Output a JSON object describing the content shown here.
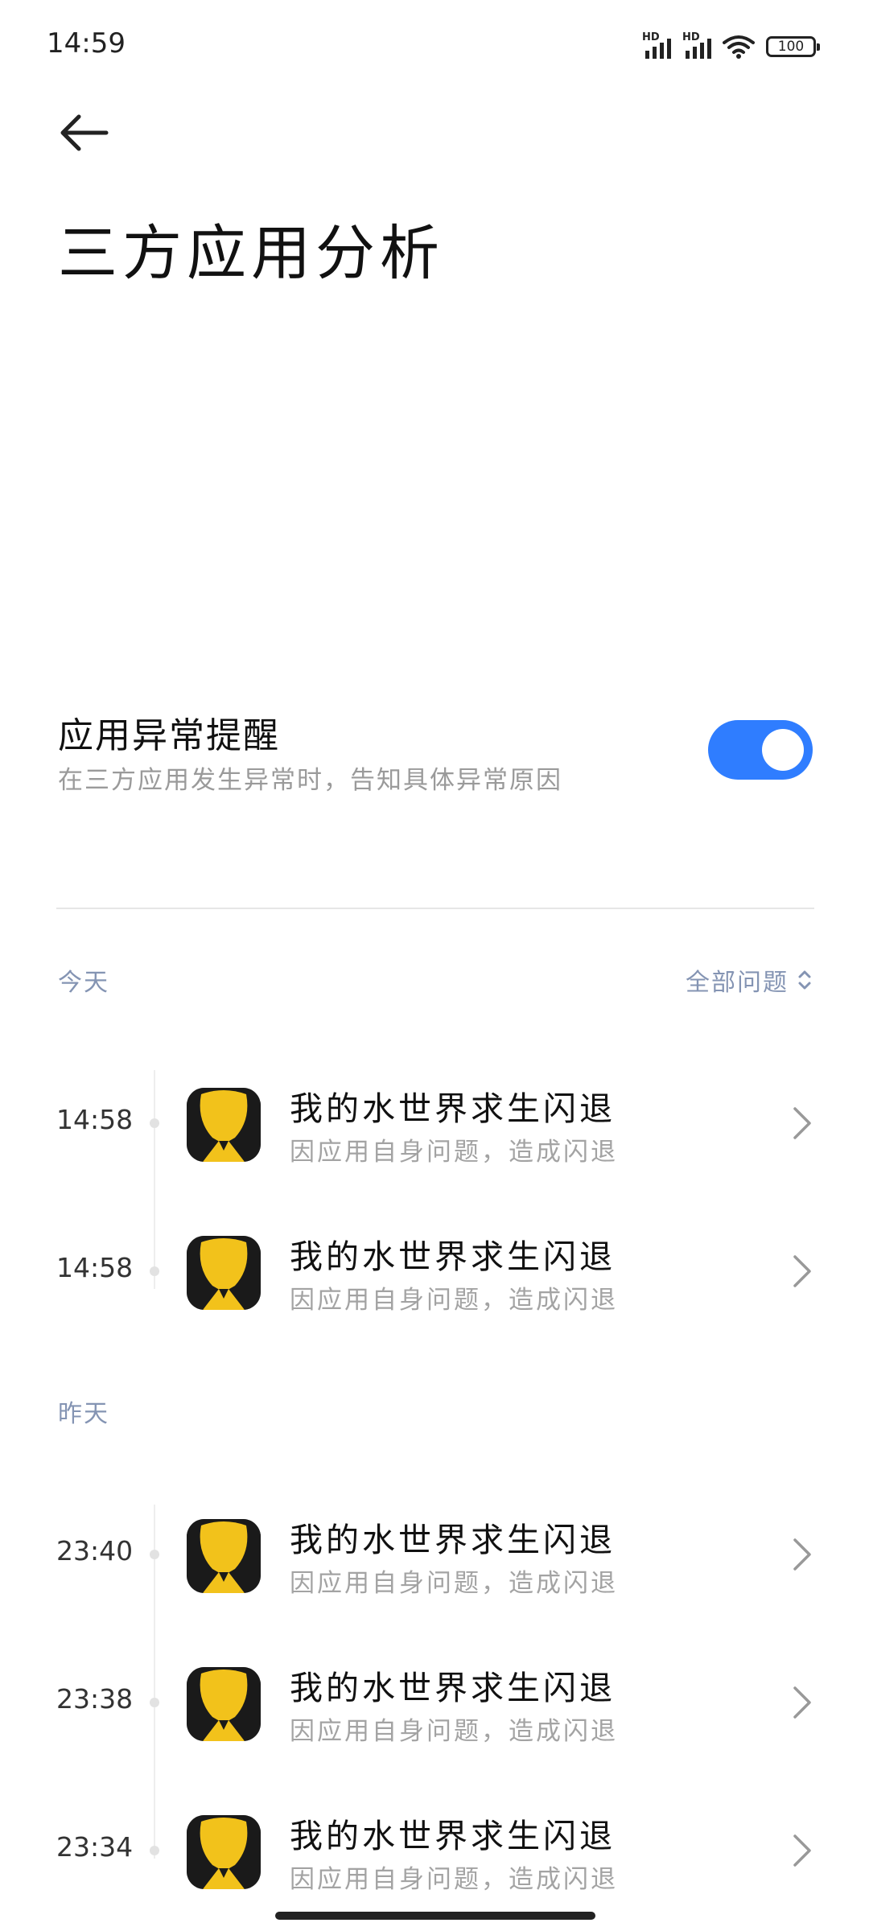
{
  "status_bar": {
    "time": "14:59",
    "sim1_label": "HD",
    "sim2_label": "HD",
    "battery": "100"
  },
  "header": {
    "back_icon": "arrow-left-icon",
    "title": "三方应用分析"
  },
  "setting": {
    "title": "应用异常提醒",
    "subtitle": "在三方应用发生异常时，告知具体异常原因",
    "toggle_on": true,
    "toggle_color": "#2f7dff"
  },
  "filter": {
    "label": "全部问题",
    "icon": "chevron-updown-icon"
  },
  "sections": [
    {
      "label": "今天",
      "items": [
        {
          "time": "14:58",
          "name": "我的水世界求生闪退",
          "desc": "因应用自身问题，造成闪退"
        },
        {
          "time": "14:58",
          "name": "我的水世界求生闪退",
          "desc": "因应用自身问题，造成闪退"
        }
      ]
    },
    {
      "label": "昨天",
      "items": [
        {
          "time": "23:40",
          "name": "我的水世界求生闪退",
          "desc": "因应用自身问题，造成闪退"
        },
        {
          "time": "23:38",
          "name": "我的水世界求生闪退",
          "desc": "因应用自身问题，造成闪退"
        },
        {
          "time": "23:34",
          "name": "我的水世界求生闪退",
          "desc": "因应用自身问题，造成闪退"
        }
      ]
    }
  ],
  "colors": {
    "accent": "#2f7dff",
    "section_label": "#8494b3",
    "app_icon_yellow": "#f2c21b"
  }
}
